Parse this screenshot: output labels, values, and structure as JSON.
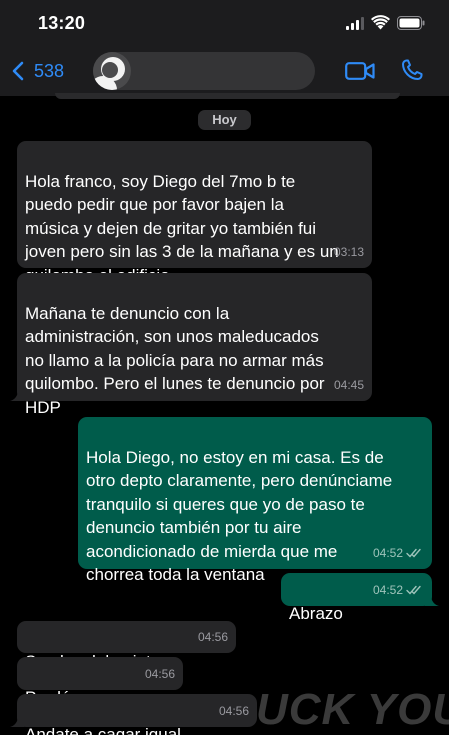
{
  "status": {
    "time": "13:20"
  },
  "header": {
    "back_count": "538"
  },
  "date_pill": "Hoy",
  "messages": [
    {
      "text": "Hola franco, soy Diego del 7mo b te\npuedo pedir que por favor bajen la\nmúsica y dejen de gritar yo también fui\njoven pero sin las 3 de la mañana y es un\nquilombo el edificio",
      "time": "03:13"
    },
    {
      "text": "Mañana te denuncio con la\nadministración, son unos maleducados\nno llamo a la policía para no armar más\nquilombo. Pero el lunes te denuncio por\nHDP",
      "time": "04:45"
    },
    {
      "text": "Hola Diego, no estoy en mi casa. Es de\notro depto claramente, pero denúnciame\ntranquilo si queres que yo de paso te\ndenuncio también por tu aire\nacondicionado de mierda que me\nchorrea toda la ventana",
      "time": "04:52"
    },
    {
      "text": "Abrazo",
      "time": "04:52"
    },
    {
      "text": "Son los del quinto",
      "time": "04:56"
    },
    {
      "text": "Perdóname",
      "time": "04:56"
    },
    {
      "text": "Andate a cagar igual",
      "time": "04:56"
    }
  ],
  "watermark": "UCK YOU",
  "colors": {
    "accent": "#2f8bf7",
    "incoming": "#262628",
    "outgoing": "#005c4b",
    "read_ticks": "#53bdeb"
  }
}
